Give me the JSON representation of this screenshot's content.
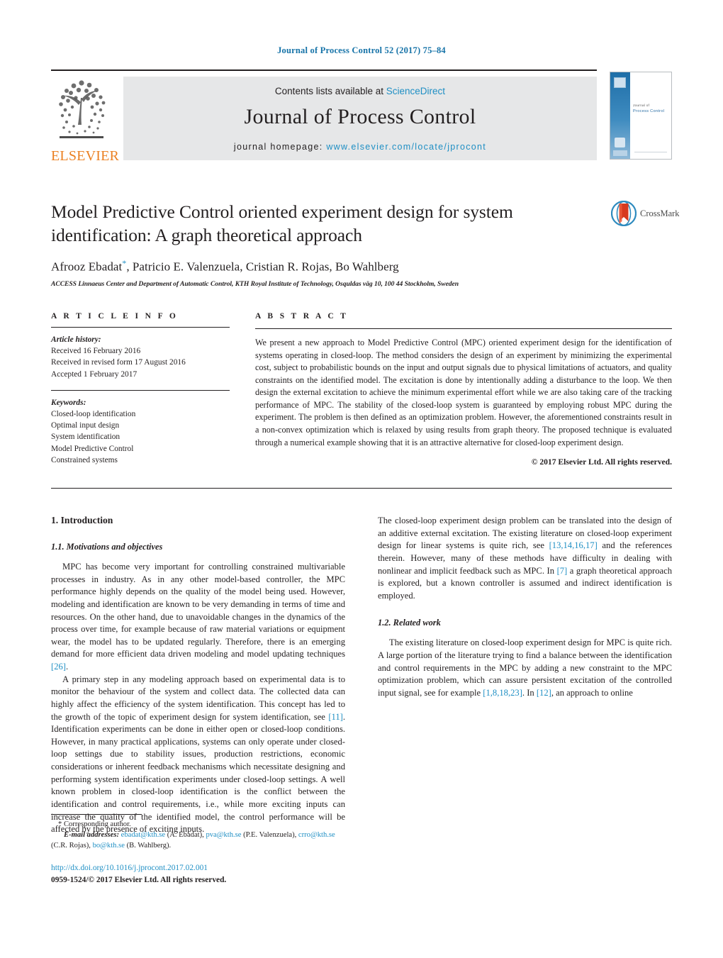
{
  "running_head": "Journal of Process Control 52 (2017) 75–84",
  "masthead": {
    "contents_prefix": "Contents lists available at",
    "contents_link": "ScienceDirect",
    "journal_title": "Journal of Process Control",
    "homepage_label": "journal homepage:",
    "homepage_url": "www.elsevier.com/locate/jprocont",
    "publisher_logo_text": "ELSEVIER",
    "cover_title_line1": "Journal of",
    "cover_title_line2": "Process Control"
  },
  "article": {
    "title_line1": "Model Predictive Control oriented experiment design for system",
    "title_line2": "identification: A graph theoretical approach",
    "authors": "Afrooz Ebadat",
    "authors_rest": ", Patricio E. Valenzuela, Cristian R. Rojas, Bo Wahlberg",
    "corresponding_marker": "*",
    "affiliation": "ACCESS Linnaeus Center and Department of Automatic Control, KTH Royal Institute of Technology, Osquldas väg 10, 100 44 Stockholm, Sweden",
    "crossmark_label": "CrossMark"
  },
  "article_info": {
    "heading": "A R T I C L E  I N F O",
    "history_label": "Article history:",
    "history": [
      "Received 16 February 2016",
      "Received in revised form 17 August 2016",
      "Accepted 1 February 2017"
    ],
    "keywords_label": "Keywords:",
    "keywords": [
      "Closed-loop identification",
      "Optimal input design",
      "System identification",
      "Model Predictive Control",
      "Constrained systems"
    ]
  },
  "abstract": {
    "heading": "A B S T R A C T",
    "text": "We present a new approach to Model Predictive Control (MPC) oriented experiment design for the identification of systems operating in closed-loop. The method considers the design of an experiment by minimizing the experimental cost, subject to probabilistic bounds on the input and output signals due to physical limitations of actuators, and quality constraints on the identified model. The excitation is done by intentionally adding a disturbance to the loop. We then design the external excitation to achieve the minimum experimental effort while we are also taking care of the tracking performance of MPC. The stability of the closed-loop system is guaranteed by employing robust MPC during the experiment. The problem is then defined as an optimization problem. However, the aforementioned constraints result in a non-convex optimization which is relaxed by using results from graph theory. The proposed technique is evaluated through a numerical example showing that it is an attractive alternative for closed-loop experiment design.",
    "copyright": "© 2017 Elsevier Ltd. All rights reserved."
  },
  "body": {
    "section1_heading": "1. Introduction",
    "section11_heading": "1.1. Motivations and objectives",
    "para_1_1": "MPC has become very important for controlling constrained multivariable processes in industry. As in any other model-based controller, the MPC performance highly depends on the quality of the model being used. However, modeling and identification are known to be very demanding in terms of time and resources. On the other hand, due to unavoidable changes in the dynamics of the process over time, for example because of raw material variations or equipment wear, the model has to be updated regularly. Therefore, there is an emerging demand for more efficient data driven modeling and model updating techniques ",
    "para_1_1_ref": "[26]",
    "para_1_1_end": ".",
    "para_1_2_a": "A primary step in any modeling approach based on experimental data is to monitor the behaviour of the system and collect data. The collected data can highly affect the efficiency of the system identification. This concept has led to the growth of the topic of experiment design for system identification, see ",
    "para_1_2_ref": "[11]",
    "para_1_2_b": ". Identification experiments can be done in either open or closed-loop conditions. However, in many practical applications, systems can only operate under closed-loop settings due to stability issues, production restrictions, economic considerations or inherent feedback mechanisms which necessitate designing and performing system identification experiments under closed-loop settings. A well known problem in closed-loop identification is the conflict between the identification and control requirements, i.e., while more exciting inputs can increase the quality of the identified model, the control performance will be affected by the presence of exciting inputs.",
    "para_1_3_a": "The closed-loop experiment design problem can be translated into the design of an additive external excitation. The existing literature on closed-loop experiment design for linear systems is quite rich, see ",
    "para_1_3_ref1": "[13,14,16,17]",
    "para_1_3_b": " and the references therein. However, many of these methods have difficulty in dealing with nonlinear and implicit feedback such as MPC. In ",
    "para_1_3_ref2": "[7]",
    "para_1_3_c": " a graph theoretical approach is explored, but a known controller is assumed and indirect identification is employed.",
    "section12_heading": "1.2. Related work",
    "para_1_4_a": "The existing literature on closed-loop experiment design for MPC is quite rich. A large portion of the literature trying to find a balance between the identification and control requirements in the MPC by adding a new constraint to the MPC optimization problem, which can assure persistent excitation of the controlled input signal, see for example ",
    "para_1_4_ref1": "[1,8,18,23]",
    "para_1_4_b": ". In ",
    "para_1_4_ref2": "[12]",
    "para_1_4_c": ", an approach to online"
  },
  "footnotes": {
    "corresponding": "* Corresponding author.",
    "email_label": "E-mail addresses:",
    "emails": [
      {
        "address": "ebadat@kth.se",
        "name": " (A. Ebadat), "
      },
      {
        "address": "pva@kth.se",
        "name": " (P.E. Valenzuela), "
      },
      {
        "address": "crro@kth.se",
        "name": " (C.R. Rojas), "
      },
      {
        "address": "bo@kth.se",
        "name": " (B. Wahlberg)."
      }
    ],
    "doi": "http://dx.doi.org/10.1016/j.jprocont.2017.02.001",
    "issn_line": "0959-1524/© 2017 Elsevier Ltd. All rights reserved."
  },
  "colors": {
    "link": "#1f8fc4",
    "running_head": "#1673a8",
    "elsevier_orange": "#eb8022",
    "banner_gray": "#e6e7e8"
  }
}
